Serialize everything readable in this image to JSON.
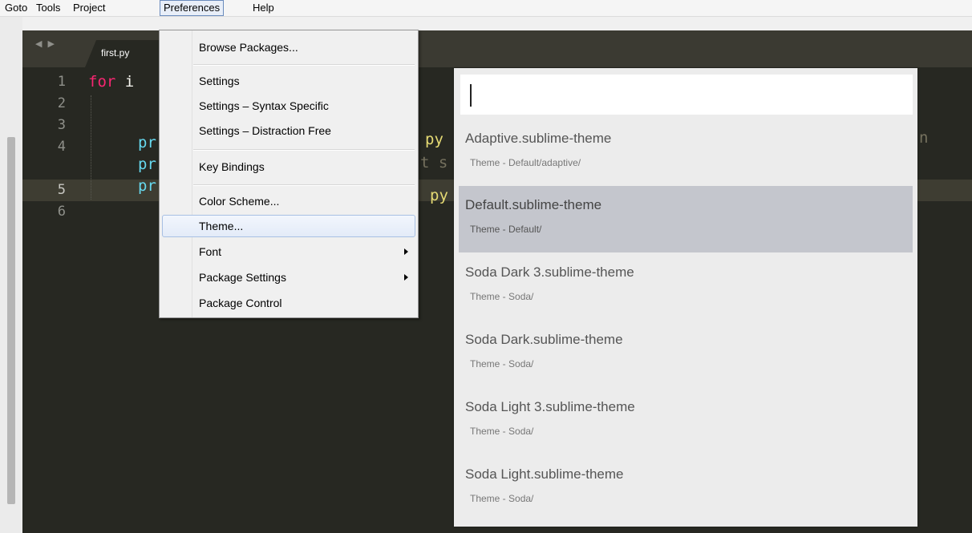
{
  "menubar": {
    "items": [
      "Goto",
      "Tools",
      "Project",
      "Preferences",
      "Help"
    ]
  },
  "tabs": {
    "nav": "◀ ▶",
    "active_tab": "first.py"
  },
  "editor": {
    "line_numbers": [
      "1",
      "2",
      "3",
      "4",
      "5",
      "6"
    ],
    "line1_kw": "for",
    "line1_id": "i",
    "line3_fn": "pr",
    "line3_str": "py",
    "line3_tail": "n",
    "line4_fn": "pr",
    "line4_dim": "t s",
    "line5_fn": "pr",
    "line5_str": "py"
  },
  "preferences_menu": {
    "browse_packages": "Browse Packages...",
    "settings": "Settings",
    "settings_syntax": "Settings – Syntax Specific",
    "settings_distraction": "Settings – Distraction Free",
    "key_bindings": "Key Bindings",
    "color_scheme": "Color Scheme...",
    "theme": "Theme...",
    "font": "Font",
    "package_settings": "Package Settings",
    "package_control": "Package Control"
  },
  "quick_panel": {
    "input_value": "",
    "items": [
      {
        "title": "Adaptive.sublime-theme",
        "path": "Theme - Default/adaptive/"
      },
      {
        "title": "Default.sublime-theme",
        "path": "Theme - Default/"
      },
      {
        "title": "Soda Dark 3.sublime-theme",
        "path": "Theme - Soda/"
      },
      {
        "title": "Soda Dark.sublime-theme",
        "path": "Theme - Soda/"
      },
      {
        "title": "Soda Light 3.sublime-theme",
        "path": "Theme - Soda/"
      },
      {
        "title": "Soda Light.sublime-theme",
        "path": "Theme - Soda/"
      }
    ],
    "selected_index": 1
  },
  "colors": {
    "editor_bg": "#272822",
    "keyword": "#f92672",
    "function": "#66d9ef",
    "string": "#e6db74",
    "selection": "#c4c6cd"
  }
}
